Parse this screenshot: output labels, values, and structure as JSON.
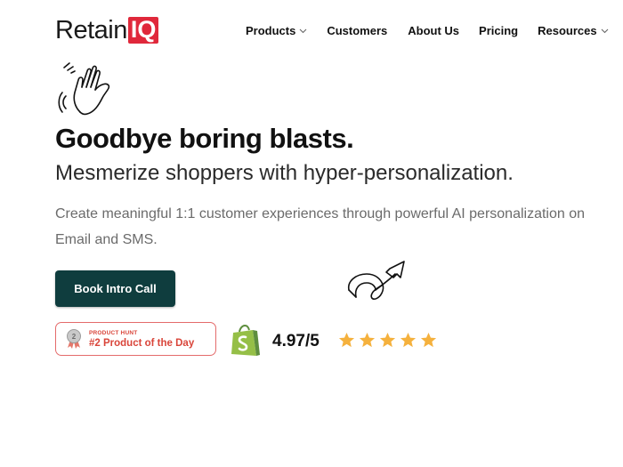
{
  "logo": {
    "word": "Retain",
    "box": "IQ",
    "box_color": "#e0283b"
  },
  "nav": {
    "items": [
      {
        "label": "Products",
        "has_dropdown": true
      },
      {
        "label": "Customers",
        "has_dropdown": false
      },
      {
        "label": "About Us",
        "has_dropdown": false
      },
      {
        "label": "Pricing",
        "has_dropdown": false
      },
      {
        "label": "Resources",
        "has_dropdown": true
      }
    ]
  },
  "hero": {
    "wave_icon": "waving-hand-icon",
    "headline": "Goodbye boring blasts.",
    "subheadline": "Mesmerize shoppers with hyper-personalization.",
    "description": "Create meaningful 1:1 customer experiences through powerful AI personalization on Email and SMS.",
    "cta_label": "Book Intro Call",
    "cta_color": "#0f3d3e",
    "arrow_icon": "curly-arrow-icon"
  },
  "badges": {
    "product_hunt": {
      "small": "PRODUCT HUNT",
      "big": "#2 Product of the Day",
      "color": "#d9453a",
      "icon": "medal-icon"
    },
    "shopify": {
      "icon": "shopify-bag-icon",
      "color": "#95bf47",
      "rating": "4.97/5",
      "stars": 5,
      "star_color": "#f5b13d"
    }
  }
}
